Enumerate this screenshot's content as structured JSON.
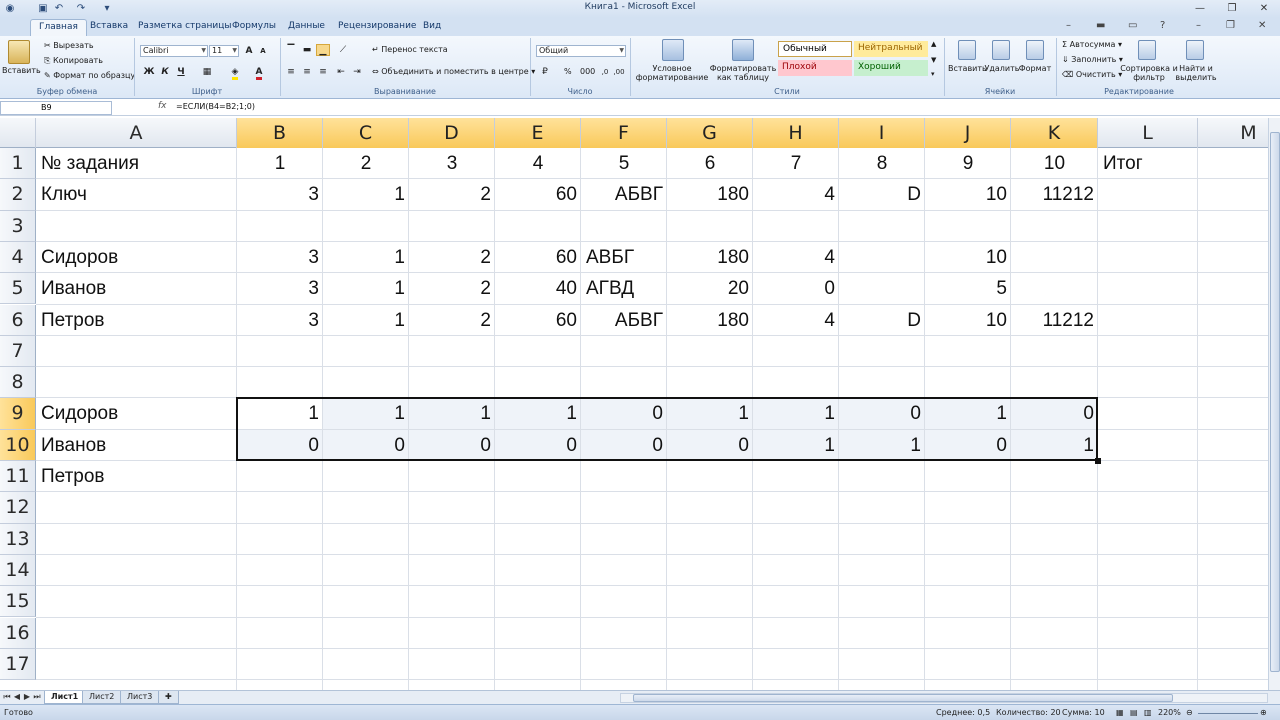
{
  "window": {
    "title": "Книга1 - Microsoft Excel"
  },
  "tabs": [
    "Главная",
    "Вставка",
    "Разметка страницы",
    "Формулы",
    "Данные",
    "Рецензирование",
    "Вид"
  ],
  "ribbon": {
    "clipboard": {
      "paste": "Вставить",
      "cut": "Вырезать",
      "copy": "Копировать",
      "format_painter": "Формат по образцу",
      "label": "Буфер обмена"
    },
    "font": {
      "name": "Calibri",
      "size": "11",
      "bold": "Ж",
      "italic": "К",
      "underline": "Ч",
      "label": "Шрифт",
      "font_color": "#d0202b",
      "fill_color": "#ffe600"
    },
    "alignment": {
      "wrap": "Перенос текста",
      "merge": "Объединить и поместить в центре",
      "label": "Выравнивание"
    },
    "number": {
      "format": "Общий",
      "percent": "%",
      "thousands": "000",
      "label": "Число"
    },
    "styles": {
      "conditional": "Условное форматирование",
      "as_table": "Форматировать как таблицу",
      "normal": "Обычный",
      "neutral": "Нейтральный",
      "bad": "Плохой",
      "good": "Хороший",
      "label": "Стили",
      "neutral_bg": "#ffeb9c",
      "bad_bg": "#ffc7ce",
      "good_bg": "#c6efce"
    },
    "cells": {
      "insert": "Вставить",
      "delete": "Удалить",
      "format": "Формат",
      "label": "Ячейки"
    },
    "editing": {
      "autosum": "Автосумма",
      "fill": "Заполнить",
      "clear": "Очистить",
      "sort": "Сортировка и фильтр",
      "find": "Найти и выделить",
      "label": "Редактирование"
    }
  },
  "formula_bar": {
    "name_box": "B9",
    "fx": "fx",
    "formula": "=ЕСЛИ(B4=B2;1;0)"
  },
  "columns": [
    "A",
    "B",
    "C",
    "D",
    "E",
    "F",
    "G",
    "H",
    "I",
    "J",
    "K",
    "L",
    "M"
  ],
  "rows": [
    "1",
    "2",
    "3",
    "4",
    "5",
    "6",
    "7",
    "8",
    "9",
    "10",
    "11",
    "12",
    "13",
    "14",
    "15",
    "16",
    "17"
  ],
  "cells": [
    [
      "№ задания",
      "1",
      "2",
      "3",
      "4",
      "5",
      "6",
      "7",
      "8",
      "9",
      "10",
      "Итог"
    ],
    [
      "Ключ",
      "3",
      "1",
      "2",
      "60",
      "АБВГ",
      "180",
      "4",
      "D",
      "10",
      "11212",
      ""
    ],
    [
      "",
      "",
      "",
      "",
      "",
      "",
      "",
      "",
      "",
      "",
      "",
      ""
    ],
    [
      "Сидоров",
      "3",
      "1",
      "2",
      "60",
      "АВБГ",
      "180",
      "4",
      "",
      "10",
      "",
      ""
    ],
    [
      "Иванов",
      "3",
      "1",
      "2",
      "40",
      "АГВД",
      "20",
      "0",
      "",
      "5",
      "",
      ""
    ],
    [
      "Петров",
      "3",
      "1",
      "2",
      "60",
      "АБВГ",
      "180",
      "4",
      "D",
      "10",
      "11212",
      ""
    ],
    [
      "",
      "",
      "",
      "",
      "",
      "",
      "",
      "",
      "",
      "",
      "",
      ""
    ],
    [
      "",
      "",
      "",
      "",
      "",
      "",
      "",
      "",
      "",
      "",
      "",
      ""
    ],
    [
      "Сидоров",
      "1",
      "1",
      "1",
      "1",
      "0",
      "1",
      "1",
      "0",
      "1",
      "0",
      ""
    ],
    [
      "Иванов",
      "0",
      "0",
      "0",
      "0",
      "0",
      "0",
      "1",
      "1",
      "0",
      "1",
      ""
    ],
    [
      "Петров",
      "",
      "",
      "",
      "",
      "",
      "",
      "",
      "",
      "",
      "",
      ""
    ]
  ],
  "sheets": [
    "Лист1",
    "Лист2",
    "Лист3"
  ],
  "status": {
    "ready": "Готово",
    "average": "Среднее: 0,5",
    "count": "Количество: 20",
    "sum": "Сумма: 10",
    "zoom": "220%"
  }
}
